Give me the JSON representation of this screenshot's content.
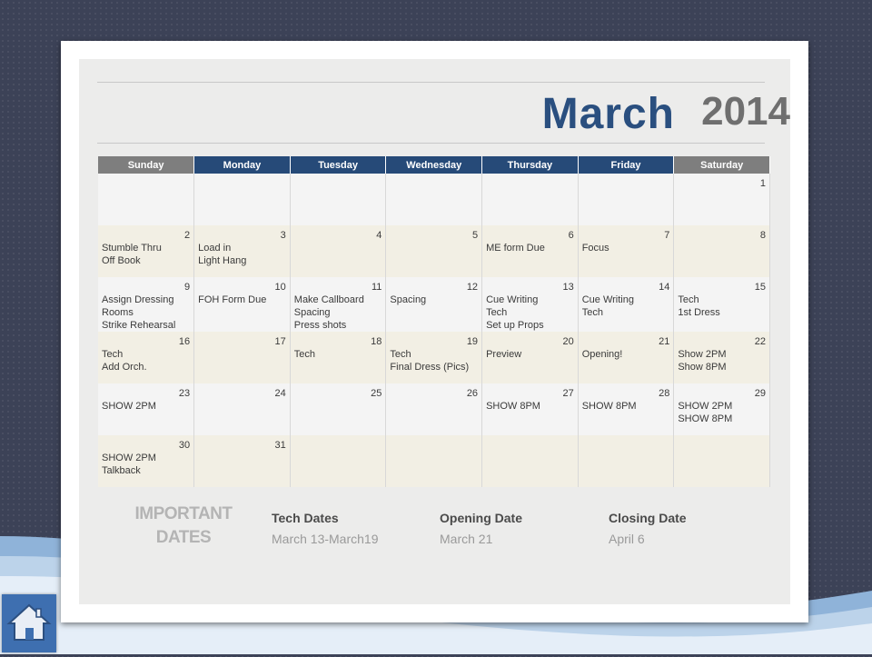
{
  "title": {
    "month": "March",
    "year": "2014"
  },
  "weekdays": [
    "Sunday",
    "Monday",
    "Tuesday",
    "Wednesday",
    "Thursday",
    "Friday",
    "Saturday"
  ],
  "weeks": [
    [
      {
        "day": "",
        "events": ""
      },
      {
        "day": "",
        "events": ""
      },
      {
        "day": "",
        "events": ""
      },
      {
        "day": "",
        "events": ""
      },
      {
        "day": "",
        "events": ""
      },
      {
        "day": "",
        "events": ""
      },
      {
        "day": "1",
        "events": ""
      }
    ],
    [
      {
        "day": "2",
        "events": "Stumble Thru\nOff Book"
      },
      {
        "day": "3",
        "events": "Load in\nLight Hang"
      },
      {
        "day": "4",
        "events": ""
      },
      {
        "day": "5",
        "events": ""
      },
      {
        "day": "6",
        "events": "ME form Due"
      },
      {
        "day": "7",
        "events": "Focus"
      },
      {
        "day": "8",
        "events": ""
      }
    ],
    [
      {
        "day": "9",
        "events": "Assign Dressing\nRooms\nStrike Rehearsal"
      },
      {
        "day": "10",
        "events": "FOH Form Due"
      },
      {
        "day": "11",
        "events": "Make Callboard\nSpacing\nPress shots"
      },
      {
        "day": "12",
        "events": "Spacing"
      },
      {
        "day": "13",
        "events": "Cue Writing\nTech\nSet up Props"
      },
      {
        "day": "14",
        "events": "Cue Writing\nTech"
      },
      {
        "day": "15",
        "events": "Tech\n1st Dress"
      }
    ],
    [
      {
        "day": "16",
        "events": "Tech\nAdd Orch."
      },
      {
        "day": "17",
        "events": ""
      },
      {
        "day": "18",
        "events": "Tech"
      },
      {
        "day": "19",
        "events": "Tech\nFinal Dress (Pics)"
      },
      {
        "day": "20",
        "events": "Preview"
      },
      {
        "day": "21",
        "events": "Opening!"
      },
      {
        "day": "22",
        "events": "Show 2PM\nShow 8PM"
      }
    ],
    [
      {
        "day": "23",
        "events": "SHOW 2PM"
      },
      {
        "day": "24",
        "events": ""
      },
      {
        "day": "25",
        "events": ""
      },
      {
        "day": "26",
        "events": ""
      },
      {
        "day": "27",
        "events": "SHOW 8PM"
      },
      {
        "day": "28",
        "events": "SHOW 8PM"
      },
      {
        "day": "29",
        "events": "SHOW 2PM\nSHOW 8PM"
      }
    ],
    [
      {
        "day": "30",
        "events": "SHOW 2PM\nTalkback"
      },
      {
        "day": "31",
        "events": ""
      },
      {
        "day": "",
        "events": ""
      },
      {
        "day": "",
        "events": ""
      },
      {
        "day": "",
        "events": ""
      },
      {
        "day": "",
        "events": ""
      },
      {
        "day": "",
        "events": ""
      }
    ]
  ],
  "important": {
    "heading_line1": "IMPORTANT",
    "heading_line2": "DATES",
    "tech": {
      "label": "Tech Dates",
      "value": "March 13-March19"
    },
    "opening": {
      "label": "Opening Date",
      "value": "March 21"
    },
    "closing": {
      "label": "Closing Date",
      "value": "April 6"
    }
  },
  "home_icon": "home-icon",
  "colors": {
    "weekday_header": "#264a78",
    "weekend_header": "#7e7e7e",
    "month_title": "#2a4f7f"
  }
}
